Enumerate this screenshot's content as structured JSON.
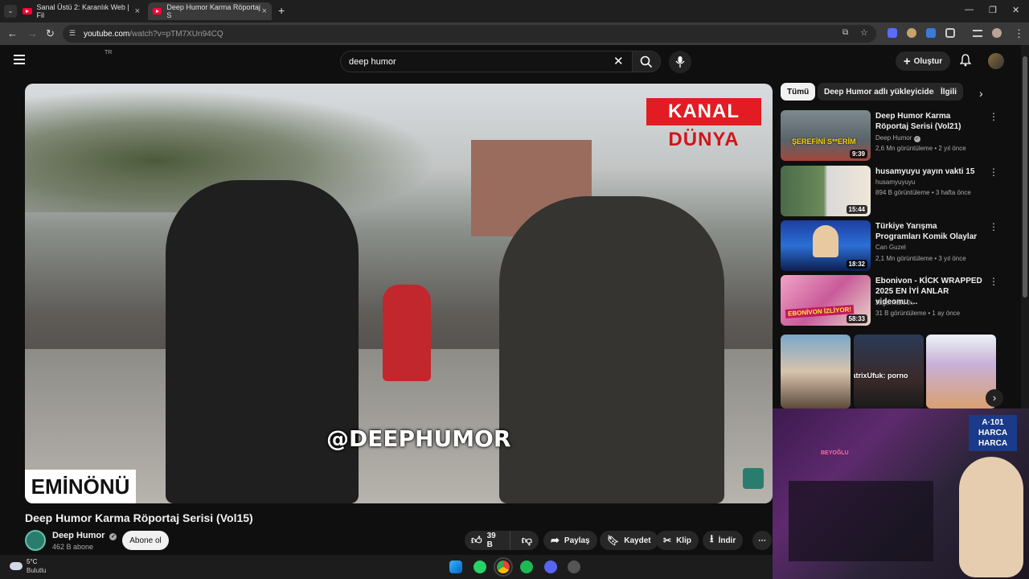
{
  "browser": {
    "tabs": [
      {
        "title": "Sanal Üstü 2: Karanlık Web | Fil"
      },
      {
        "title": "Deep Humor Karma Röportaj S"
      }
    ],
    "url_host": "youtube.com",
    "url_path": "/watch?v=pTM7XUn94CQ"
  },
  "header": {
    "region_code": "TR",
    "search_value": "deep humor",
    "create_label": "Oluştur"
  },
  "player": {
    "overlay_top_line1": "KANAL",
    "overlay_top_line2": "DÜNYA",
    "watermark": "@DEEPHUMOR",
    "location_label": "EMİNÖNÜ"
  },
  "video": {
    "title": "Deep Humor Karma Röportaj Serisi (Vol15)",
    "channel_name": "Deep Humor",
    "subscribers": "462 B abone",
    "subscribe_label": "Abone ol",
    "likes": "39 B",
    "share_label": "Paylaş",
    "save_label": "Kaydet",
    "clip_label": "Klip",
    "download_label": "İndir"
  },
  "sidebar": {
    "chips": [
      "Tümü",
      "Deep Humor adlı yükleyiciden",
      "İlgili"
    ],
    "recommendations": [
      {
        "title": "Deep Humor Karma Röportaj Serisi (Vol21)",
        "channel": "Deep Humor",
        "meta": "2,6 Mn görüntüleme • 2 yıl önce",
        "duration": "9:39",
        "thumb_text": "ŞEREFİNİ S**ERİM"
      },
      {
        "title": "husamyuyu yayın vakti 15",
        "channel": "husamyuyuyu",
        "meta": "894 B görüntüleme • 3 hafta önce",
        "duration": "15:44"
      },
      {
        "title": "Türkiye Yarışma Programları Komik Olaylar",
        "channel": "Can Guzel",
        "meta": "2,1 Mn görüntüleme • 3 yıl önce",
        "duration": "18:32"
      },
      {
        "title": "Ebonivon - KİCK WRAPPED 2025 EN İYİ ANLAR videomu ...",
        "channel": "JagermaN Jr.",
        "meta": "31 B görüntüleme • 1 ay önce",
        "duration": "58:33",
        "thumb_text": "EBONİVON İZLİYOR!"
      }
    ],
    "short_caption": "MatrixUfuk: porno"
  },
  "webcam": {
    "sign_text": "A·101 HARCA HARCA",
    "neon_text": "BEYOĞLU"
  },
  "taskbar": {
    "weather_temp": "5°C",
    "weather_desc": "Bulutlu"
  }
}
